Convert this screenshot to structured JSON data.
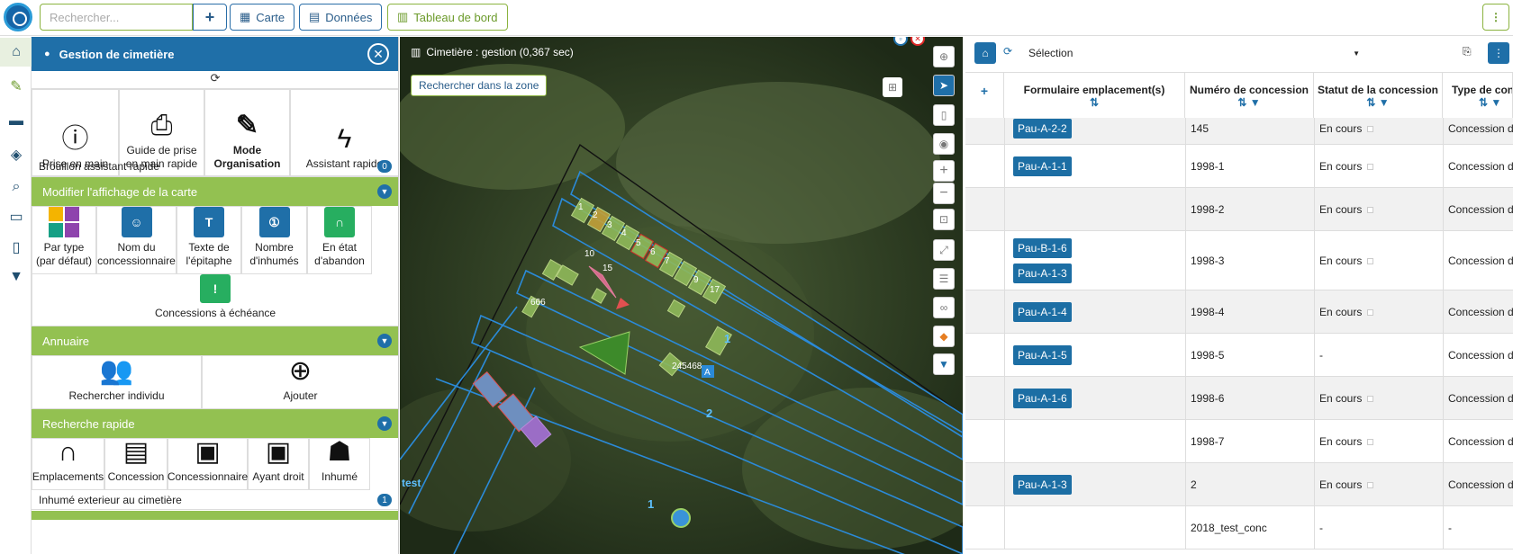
{
  "topbar": {
    "search_placeholder": "Rechercher...",
    "add_label": "+",
    "carte_label": "Carte",
    "donnees_label": "Données",
    "tableau_label": "Tableau de bord",
    "menu_label": "⋮"
  },
  "panel": {
    "title": "Gestion de cimetière",
    "top_tools": [
      {
        "label1": "Prise en main",
        "label2": ""
      },
      {
        "label1": "Guide de prise",
        "label2": "en main rapide"
      },
      {
        "label1": "Mode",
        "label2": "Organisation"
      },
      {
        "label1": "Assistant rapide",
        "label2": ""
      }
    ],
    "brouillon_label": "Brouillon assistant rapide",
    "brouillon_count": "0",
    "section_affichage": "Modifier l'affichage de la carte",
    "affichage_items": [
      {
        "l1": "Par type",
        "l2": "(par défaut)"
      },
      {
        "l1": "Nom du",
        "l2": "concessionnaire"
      },
      {
        "l1": "Texte de",
        "l2": "l'épitaphe"
      },
      {
        "l1": "Nombre",
        "l2": "d'inhumés"
      },
      {
        "l1": "En état",
        "l2": "d'abandon"
      }
    ],
    "echeance_label": "Concessions à échéance",
    "section_annuaire": "Annuaire",
    "annuaire_items": [
      {
        "label": "Rechercher individu"
      },
      {
        "label": "Ajouter"
      }
    ],
    "section_recherche": "Recherche rapide",
    "recherche_items": [
      {
        "label": "Emplacements"
      },
      {
        "label": "Concession"
      },
      {
        "label": "Concessionnaire"
      },
      {
        "label": "Ayant droit"
      },
      {
        "label": "Inhumé"
      }
    ],
    "inhume_ext_label": "Inhumé exterieur au cimetière",
    "inhume_ext_count": "1"
  },
  "map": {
    "title": "Cimetière : gestion (0,367 sec)",
    "zone_button": "Rechercher dans la zone",
    "labels": {
      "l1": "1",
      "l2": "2",
      "l3": "3",
      "l4": "4",
      "l5": "5",
      "l6": "6",
      "l7": "7",
      "l9": "9",
      "l17": "17",
      "l10": "10",
      "l15": "15",
      "l666": "666",
      "l245": "245468",
      "lA": "A",
      "lrow1": "1",
      "lrow2": "2",
      "ltest": "test"
    }
  },
  "table": {
    "selection_label": "Sélection",
    "columns": [
      {
        "title": "Formulaire emplacement(s)"
      },
      {
        "title": "Numéro de concession"
      },
      {
        "title": "Statut de la concession"
      },
      {
        "title": "Type de concession"
      }
    ],
    "rows": [
      {
        "tags": [
          "Pau-A-2-2"
        ],
        "numero": "145",
        "statut": "En cours",
        "type": "Concession de famil"
      },
      {
        "tags": [
          "Pau-A-1-1"
        ],
        "numero": "1998-1",
        "statut": "En cours",
        "type": "Concession de famil"
      },
      {
        "tags": [],
        "numero": "1998-2",
        "statut": "En cours",
        "type": "Concession de famil"
      },
      {
        "tags": [
          "Pau-B-1-6",
          "Pau-A-1-3"
        ],
        "numero": "1998-3",
        "statut": "En cours",
        "type": "Concession de famil"
      },
      {
        "tags": [
          "Pau-A-1-4"
        ],
        "numero": "1998-4",
        "statut": "En cours",
        "type": "Concession de famil"
      },
      {
        "tags": [
          "Pau-A-1-5"
        ],
        "numero": "1998-5",
        "statut": "-",
        "type": "Concession de famil"
      },
      {
        "tags": [
          "Pau-A-1-6"
        ],
        "numero": "1998-6",
        "statut": "En cours",
        "type": "Concession de famil"
      },
      {
        "tags": [],
        "numero": "1998-7",
        "statut": "En cours",
        "type": "Concession de famil"
      },
      {
        "tags": [
          "Pau-A-1-3"
        ],
        "numero": "2",
        "statut": "En cours",
        "type": "Concession de famil"
      },
      {
        "tags": [],
        "numero": "2018_test_conc",
        "statut": "-",
        "type": "-"
      }
    ]
  }
}
